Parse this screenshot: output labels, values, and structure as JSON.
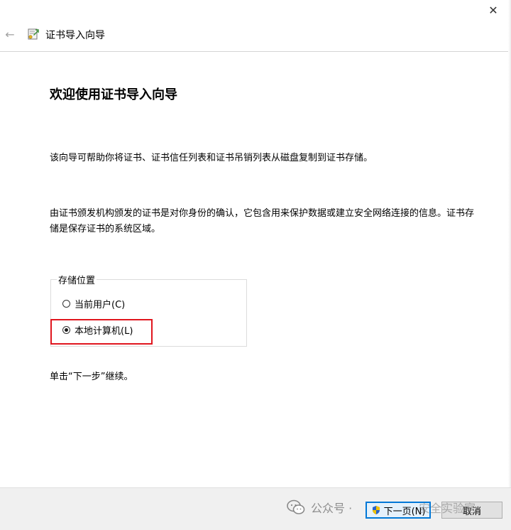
{
  "window": {
    "close_glyph": "✕"
  },
  "header": {
    "back_glyph": "←",
    "title": "证书导入向导",
    "icon": "certificate-wizard-icon"
  },
  "main": {
    "heading": "欢迎使用证书导入向导",
    "paragraph1": "该向导可帮助你将证书、证书信任列表和证书吊销列表从磁盘复制到证书存储。",
    "paragraph2": "由证书颁发机构颁发的证书是对你身份的确认，它包含用来保护数据或建立安全网络连接的信息。证书存储是保存证书的系统区域。",
    "store_location": {
      "legend": "存储位置",
      "options": [
        {
          "label": "当前用户(C)",
          "checked": false
        },
        {
          "label": "本地计算机(L)",
          "checked": true
        }
      ]
    },
    "instruction": "单击“下一步”继续。"
  },
  "footer": {
    "next_label": "下一页(N)",
    "cancel_label": "取消"
  },
  "watermark": {
    "text": "公众号 · ",
    "text_right": "安全实验室"
  },
  "colors": {
    "highlight": "#e0161e",
    "focus_border": "#0078d7"
  }
}
